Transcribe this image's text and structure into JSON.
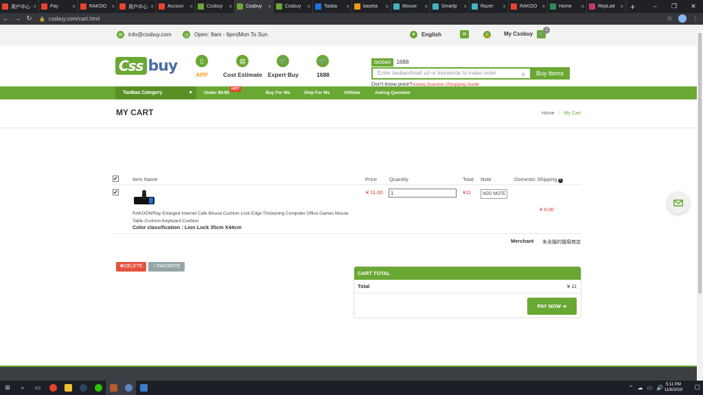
{
  "browser": {
    "tabs": [
      {
        "label": "用户中心",
        "color": "#e8432c",
        "icon": "weidian-icon"
      },
      {
        "label": "Pay",
        "color": "#e8432c",
        "icon": "weidian-icon"
      },
      {
        "label": "RAKOO",
        "color": "#e8432c",
        "icon": "weidian-icon"
      },
      {
        "label": "用户中心",
        "color": "#e8432c",
        "icon": "weidian-icon"
      },
      {
        "label": "Accoun",
        "color": "#e8432c",
        "icon": "weidian-icon"
      },
      {
        "label": "Cssbuy",
        "color": "#6aa834",
        "icon": "cssbuy-icon"
      },
      {
        "label": "Cssbuy",
        "color": "#6aa834",
        "icon": "cssbuy-icon",
        "active": true
      },
      {
        "label": "Cssbuy",
        "color": "#6aa834",
        "icon": "cssbuy-icon"
      },
      {
        "label": "Taoba",
        "color": "#1a73e8",
        "icon": "taobao-icon"
      },
      {
        "label": "baseta",
        "color": "#f29b1c",
        "icon": "baidu-icon"
      },
      {
        "label": "Mouse",
        "color": "#44b3c2",
        "icon": "site-icon"
      },
      {
        "label": "Smartp",
        "color": "#44b3c2",
        "icon": "site-icon"
      },
      {
        "label": "Razer",
        "color": "#44b3c2",
        "icon": "site-icon"
      },
      {
        "label": "RAKOO",
        "color": "#e8432c",
        "icon": "weidian-icon"
      },
      {
        "label": "Home",
        "color": "#2e8b57",
        "icon": "medium-icon"
      },
      {
        "label": "RepLad",
        "color": "#c0396b",
        "icon": "reddit-icon"
      }
    ],
    "url": "cssbuy.com/cart.html"
  },
  "infobar": {
    "email": "info@cssbuy.com",
    "hours": "Open: 9am - 6pm|Mon To Sun",
    "language": "English",
    "account": "My Cssbuy",
    "cart_count": "1"
  },
  "header": {
    "logo_left": "Css",
    "logo_right": "buy",
    "nav": [
      {
        "label": "APP",
        "icon": "phone-icon"
      },
      {
        "label": "Cost Estimate",
        "icon": "document-icon"
      },
      {
        "label": "Expert Buy",
        "icon": "cart-icon"
      },
      {
        "label": "1688",
        "icon": "cart-icon"
      }
    ],
    "search_tabs": [
      "taobao",
      "1688"
    ],
    "search_placeholder": "Enter taobao/tmall url or keywords to make order",
    "search_button": "Buy Items",
    "hint_text": "Don't know price?",
    "hint_link1": "Asking Question",
    "hint_link2": "Shopping Guide"
  },
  "greennav": {
    "category": "TaoBao Category",
    "items": [
      "Under $9.90",
      "Buy For Me",
      "Ship For Me",
      "Affiliate",
      "Asking Question"
    ],
    "hot_label": "HOT"
  },
  "page": {
    "title": "MY CART",
    "breadcrumb_home": "Home",
    "breadcrumb_sep": "/",
    "breadcrumb_current": "My Cart"
  },
  "cart": {
    "headers": {
      "item": "Item Name",
      "price": "Price",
      "quantity": "Quantity",
      "total": "Total",
      "note": "Note",
      "shipping": "Domestic Shipping"
    },
    "item": {
      "name": "RAKOON/Ray Enlarged Internet Cafe Mouse Cushion Lock Edge Thickening Computer Office Games Mouse Table Cushion Keyboard Cushion",
      "color": "Color classification : Lion Lock 35cm X44cm",
      "price": "¥ 11.00",
      "quantity": "1",
      "total": "¥11",
      "note_button": "ADD NOTE",
      "shipping": "¥ 0.00"
    },
    "merchant_label": "Merchant",
    "merchant_value": "朱龙猫的猫窝商店",
    "delete_button": "✖DELETE",
    "favorite_button": "♡FAVORITE"
  },
  "cart_total": {
    "heading": "CART TOTAL",
    "total_label": "Total",
    "total_value": "¥ 11",
    "pay_button": "PAY NOW"
  },
  "taskbar": {
    "time": "5:11 PM",
    "date": "11/6/2019"
  }
}
